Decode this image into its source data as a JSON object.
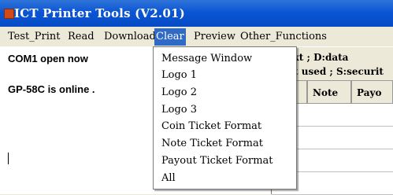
{
  "window": {
    "title": "ICT Printer Tools (V2.01)"
  },
  "menu": [
    {
      "label": "Test_Print"
    },
    {
      "label": "Read"
    },
    {
      "label": "Download"
    },
    {
      "label": "Clear"
    },
    {
      "label": "Preview"
    },
    {
      "label": "Other_Functions"
    }
  ],
  "log": {
    "lines": [
      "COM1  open now",
      "GP-58C is online ."
    ]
  },
  "info": {
    "line1": "ext ; D:data",
    "line2": "ot used ; S:securit"
  },
  "columns": [
    "n",
    "Note",
    "Payo"
  ],
  "dropdown": {
    "items": [
      "Message Window",
      "Logo 1",
      "Logo 2",
      "Logo 3",
      "Coin Ticket Format",
      "Note Ticket Format",
      "Payout Ticket Format",
      "All"
    ]
  }
}
